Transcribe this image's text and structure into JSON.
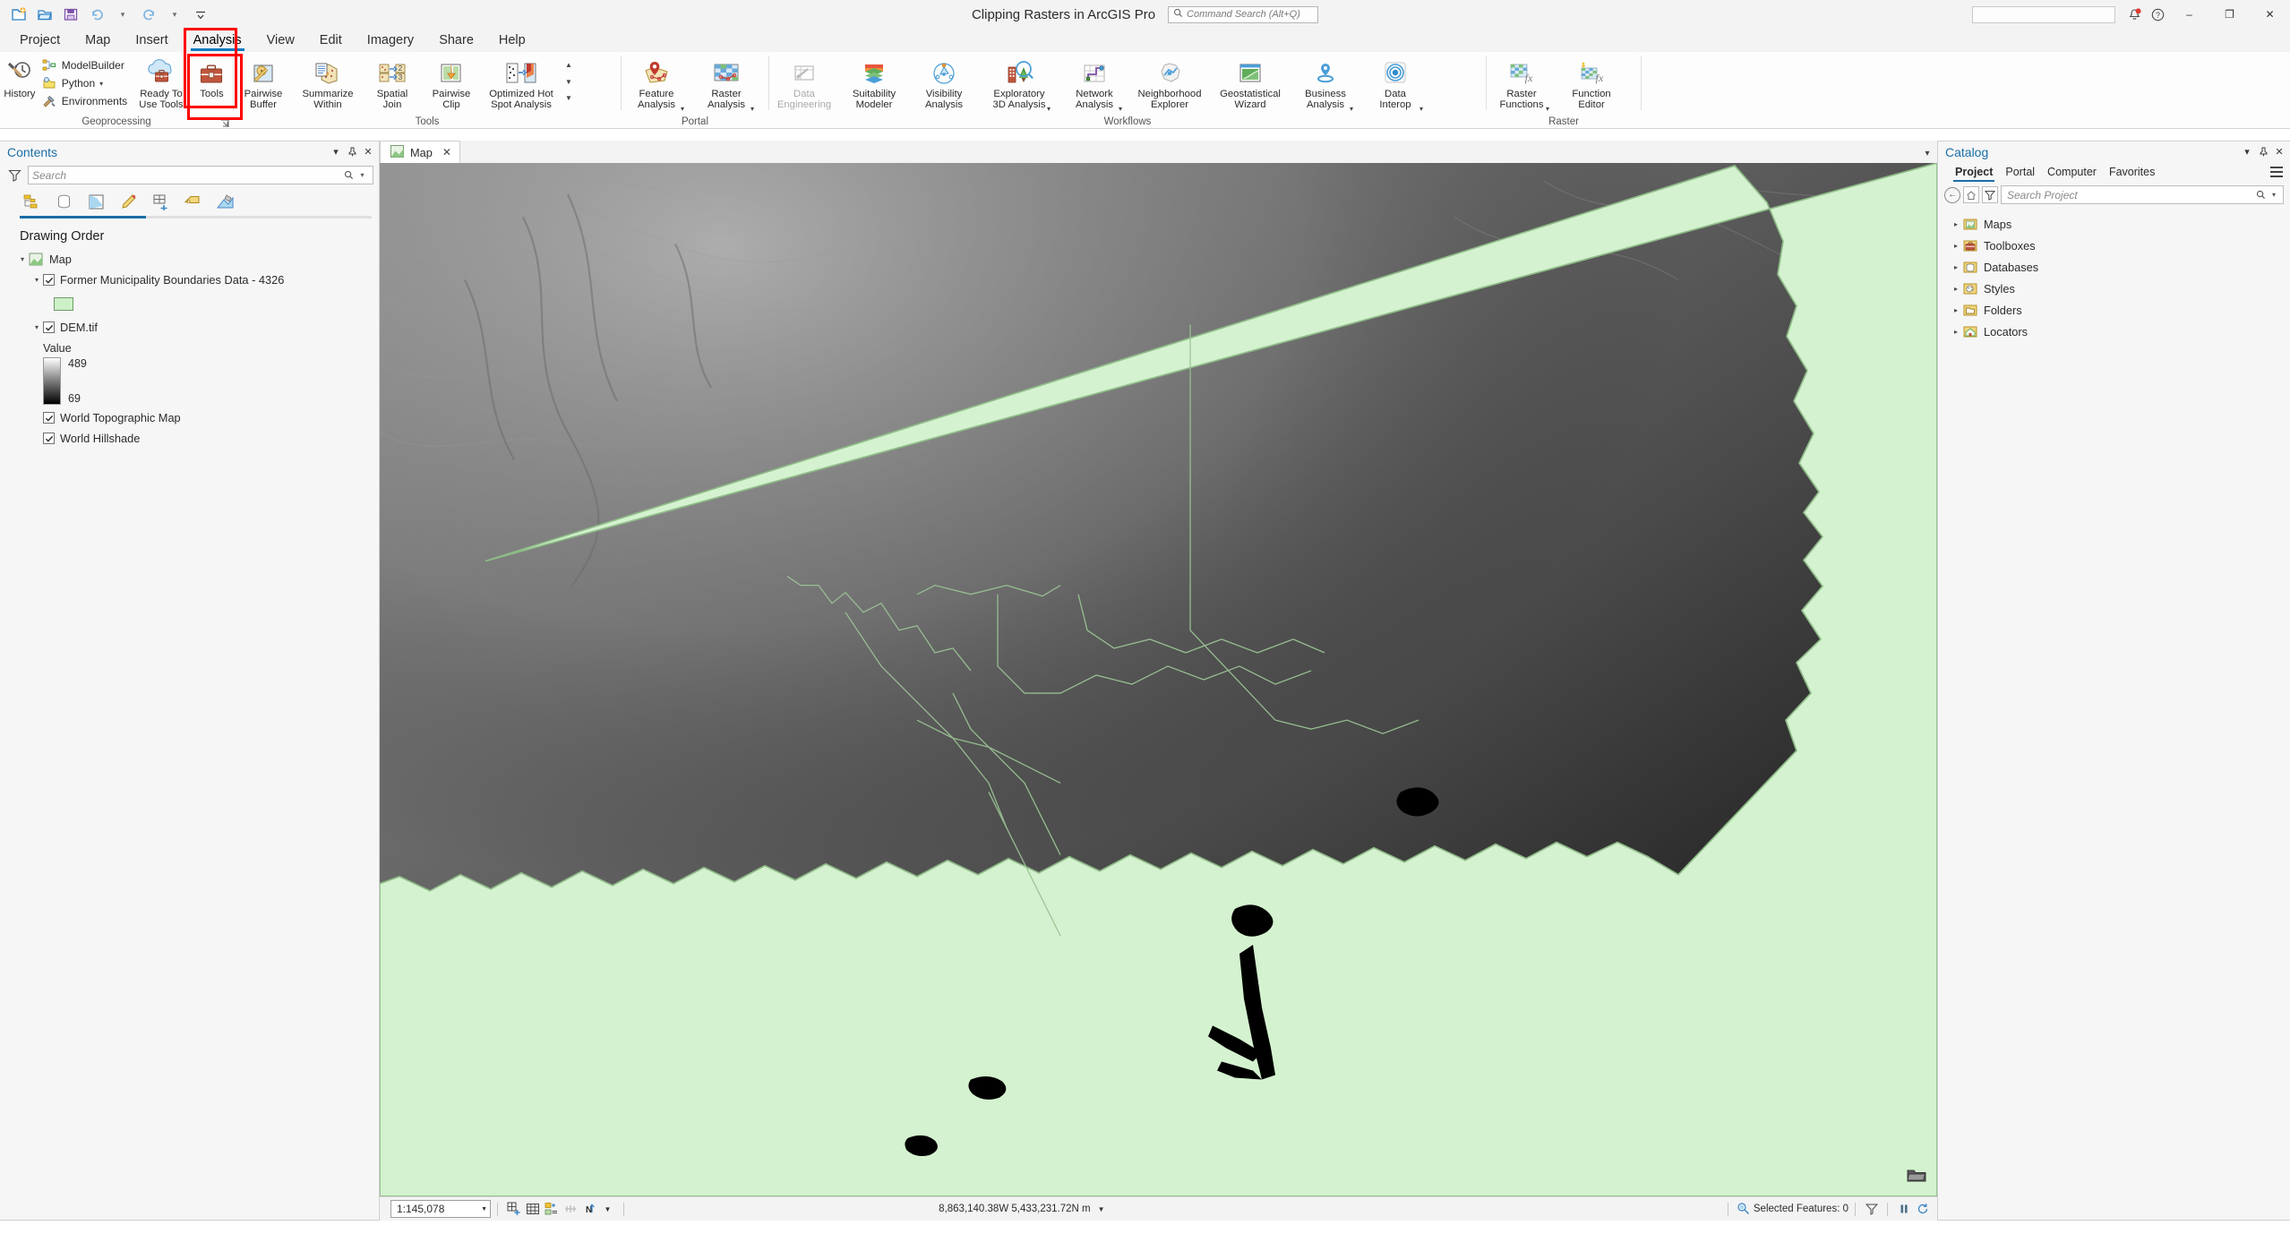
{
  "app": {
    "title": "Clipping Rasters in ArcGIS Pro",
    "command_search_placeholder": "Command Search (Alt+Q)"
  },
  "quick_access": {
    "items": [
      {
        "name": "new-project-icon",
        "label": "New Project"
      },
      {
        "name": "open-project-icon",
        "label": "Open Project"
      },
      {
        "name": "save-project-icon",
        "label": "Save Project"
      },
      {
        "name": "undo-icon",
        "label": "Undo"
      },
      {
        "name": "undo-dropdown-icon",
        "label": "Undo options"
      },
      {
        "name": "redo-icon",
        "label": "Redo"
      },
      {
        "name": "redo-dropdown-icon",
        "label": "Redo options"
      },
      {
        "name": "customize-qat-icon",
        "label": "Customize Quick Access Toolbar"
      }
    ]
  },
  "window_controls": {
    "minimize": "–",
    "maximize": "❐",
    "close": "✕"
  },
  "ribbon": {
    "tabs": [
      {
        "label": "Project",
        "active": false
      },
      {
        "label": "Map",
        "active": false
      },
      {
        "label": "Insert",
        "active": false
      },
      {
        "label": "Analysis",
        "active": true
      },
      {
        "label": "View",
        "active": false
      },
      {
        "label": "Edit",
        "active": false
      },
      {
        "label": "Imagery",
        "active": false
      },
      {
        "label": "Share",
        "active": false
      },
      {
        "label": "Help",
        "active": false
      }
    ],
    "highlight_color": "#ff0000",
    "accent_color": "#0f7bbf",
    "groups": [
      {
        "name": "geoprocessing",
        "label": "Geoprocessing",
        "big_buttons": [
          {
            "label": "History",
            "icon": "history-icon",
            "caret": false
          },
          {
            "label": "Ready To\nUse Tools",
            "icon": "ready-to-use-tools-icon",
            "caret": true
          },
          {
            "label": "Tools",
            "icon": "tools-toolbox-icon",
            "caret": false,
            "highlighted": true
          }
        ],
        "small_buttons": [
          {
            "label": "ModelBuilder",
            "icon": "modelbuilder-icon",
            "caret": false
          },
          {
            "label": "Python",
            "icon": "python-icon",
            "caret": true
          },
          {
            "label": "Environments",
            "icon": "environments-icon",
            "caret": false
          }
        ]
      },
      {
        "name": "tools",
        "label": "Tools",
        "big_buttons": [
          {
            "label": "Pairwise\nBuffer",
            "icon": "pairwise-buffer-icon"
          },
          {
            "label": "Summarize\nWithin",
            "icon": "summarize-within-icon"
          },
          {
            "label": "Spatial\nJoin",
            "icon": "spatial-join-icon"
          },
          {
            "label": "Pairwise\nClip",
            "icon": "pairwise-clip-icon"
          },
          {
            "label": "Optimized Hot\nSpot Analysis",
            "icon": "optimized-hot-spot-analysis-icon"
          }
        ]
      },
      {
        "name": "portal",
        "label": "Portal",
        "big_buttons": [
          {
            "label": "Feature\nAnalysis",
            "icon": "feature-analysis-icon",
            "caret": true
          },
          {
            "label": "Raster\nAnalysis",
            "icon": "raster-analysis-icon",
            "caret": true
          }
        ]
      },
      {
        "name": "workflows",
        "label": "Workflows",
        "big_buttons": [
          {
            "label": "Data\nEngineering",
            "icon": "data-engineering-icon",
            "caret": false,
            "disabled": true
          },
          {
            "label": "Suitability\nModeler",
            "icon": "suitability-modeler-icon",
            "caret": false
          },
          {
            "label": "Visibility\nAnalysis",
            "icon": "visibility-analysis-icon",
            "caret": false
          },
          {
            "label": "Exploratory\n3D Analysis",
            "icon": "exploratory-3d-analysis-icon",
            "caret": true
          },
          {
            "label": "Network\nAnalysis",
            "icon": "network-analysis-icon",
            "caret": true
          },
          {
            "label": "Neighborhood\nExplorer",
            "icon": "neighborhood-explorer-icon",
            "caret": false
          },
          {
            "label": "Geostatistical\nWizard",
            "icon": "geostatistical-wizard-icon",
            "caret": false
          },
          {
            "label": "Business\nAnalysis",
            "icon": "business-analysis-icon",
            "caret": true
          },
          {
            "label": "Data\nInterop",
            "icon": "data-interop-icon",
            "caret": true
          }
        ]
      },
      {
        "name": "raster",
        "label": "Raster",
        "big_buttons": [
          {
            "label": "Raster\nFunctions",
            "icon": "raster-functions-icon",
            "caret": true
          },
          {
            "label": "Function\nEditor",
            "icon": "function-editor-icon",
            "caret": false
          }
        ]
      }
    ]
  },
  "contents": {
    "title": "Contents",
    "search_placeholder": "Search",
    "toolbar_icons": [
      "list-by-drawing-order-icon",
      "list-by-data-source-icon",
      "list-by-selection-icon",
      "list-by-editing-icon",
      "list-by-snapping-icon",
      "list-by-labeling-icon",
      "list-by-diagram-icon"
    ],
    "section_label": "Drawing Order",
    "tree": {
      "map_name": "Map",
      "layers": [
        {
          "name": "Former Municipality Boundaries Data - 4326",
          "checked": true,
          "expandable": true,
          "symbol": "polygon-swatch",
          "swatch_fill": "#cdf0c8",
          "swatch_stroke": "#6f9a6a"
        },
        {
          "name": "DEM.tif",
          "checked": true,
          "expandable": true,
          "legend_label": "Value",
          "ramp_max": "489",
          "ramp_min": "69"
        },
        {
          "name": "World Topographic Map",
          "checked": true,
          "expandable": false
        },
        {
          "name": "World Hillshade",
          "checked": true,
          "expandable": false
        }
      ]
    }
  },
  "catalog": {
    "title": "Catalog",
    "tabs": [
      {
        "label": "Project",
        "active": true
      },
      {
        "label": "Portal",
        "active": false
      },
      {
        "label": "Computer",
        "active": false
      },
      {
        "label": "Favorites",
        "active": false
      }
    ],
    "search_placeholder": "Search Project",
    "items": [
      {
        "label": "Maps",
        "icon": "maps-folder-icon"
      },
      {
        "label": "Toolboxes",
        "icon": "toolboxes-folder-icon"
      },
      {
        "label": "Databases",
        "icon": "databases-folder-icon"
      },
      {
        "label": "Styles",
        "icon": "styles-folder-icon"
      },
      {
        "label": "Folders",
        "icon": "folders-folder-icon"
      },
      {
        "label": "Locators",
        "icon": "locators-folder-icon"
      }
    ]
  },
  "mapview": {
    "tab_label": "Map",
    "tab_icon": "map-tab-icon"
  },
  "statusbar": {
    "scale": "1:145,078",
    "coordinates": "8,863,140.38W 5,433,231.72N m",
    "selected_features": "Selected Features: 0",
    "tool_icons": [
      "add-view-icon",
      "grid-icon",
      "selection-icon",
      "measure-icon",
      "north-arrow-icon"
    ]
  }
}
